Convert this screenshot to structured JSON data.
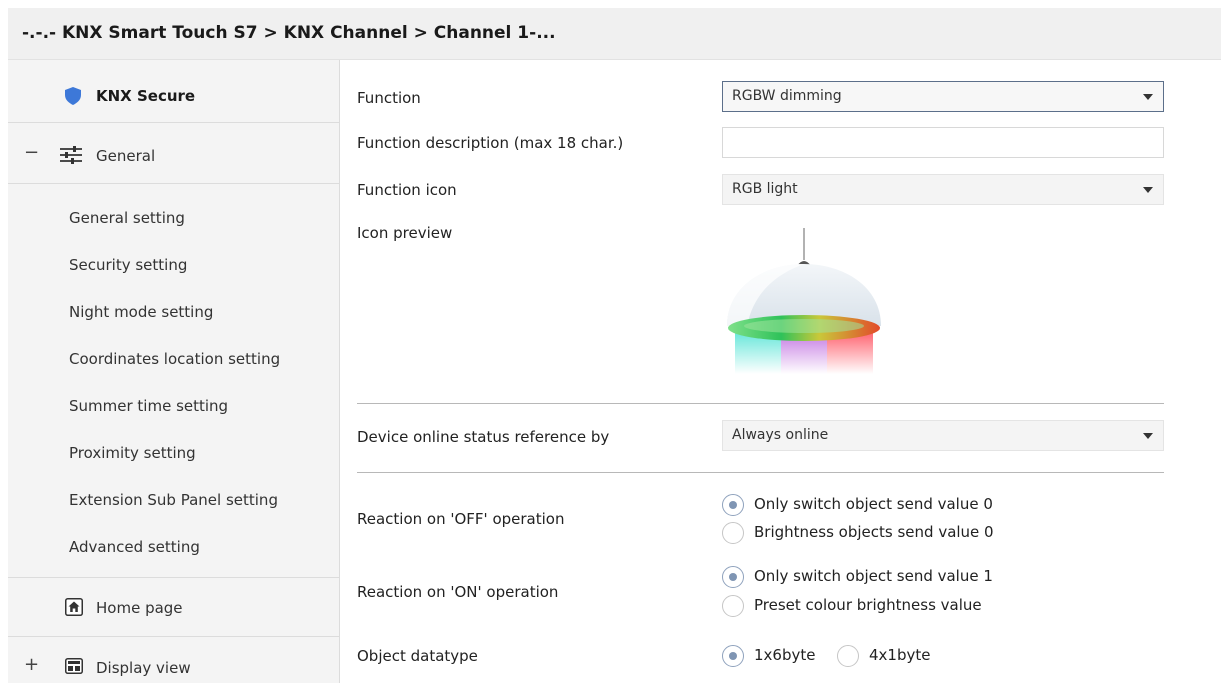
{
  "titlebar": {
    "breadcrumb": "-.-.- KNX Smart Touch S7 > KNX Channel  > Channel 1-..."
  },
  "sidebar": {
    "secure": {
      "label": "KNX Secure",
      "icon": "shield-icon"
    },
    "general": {
      "expander": "−",
      "label": "General",
      "icon": "sliders-icon"
    },
    "items": [
      "General setting",
      "Security setting",
      "Night mode setting",
      "Coordinates location setting",
      "Summer time setting",
      "Proximity setting",
      "Extension Sub Panel setting",
      "Advanced setting"
    ],
    "home": {
      "label": "Home page",
      "icon": "home-icon"
    },
    "display": {
      "expander": "+",
      "label": "Display view",
      "icon": "display-icon"
    }
  },
  "main": {
    "function": {
      "label": "Function",
      "value": "RGBW dimming"
    },
    "description": {
      "label": "Function description (max 18 char.)",
      "value": ""
    },
    "icon": {
      "label": "Function icon",
      "value": "RGB light"
    },
    "preview": {
      "label": "Icon preview",
      "icon": "rgb-pendant-lamp-icon"
    },
    "online": {
      "label": "Device online status reference by",
      "value": "Always online"
    },
    "off_reaction": {
      "label": "Reaction on 'OFF' operation",
      "options": [
        "Only switch object send value 0",
        "Brightness objects send value 0"
      ],
      "selected": 0
    },
    "on_reaction": {
      "label": "Reaction on 'ON' operation",
      "options": [
        "Only switch object send value 1",
        "Preset colour brightness value"
      ],
      "selected": 0
    },
    "datatype": {
      "label": "Object datatype",
      "options": [
        "1x6byte",
        "4x1byte"
      ],
      "selected": 0
    }
  },
  "colors": {
    "accent": "#7f95b3",
    "active_border": "#5c6f8a",
    "shield": "#3d78d8"
  }
}
